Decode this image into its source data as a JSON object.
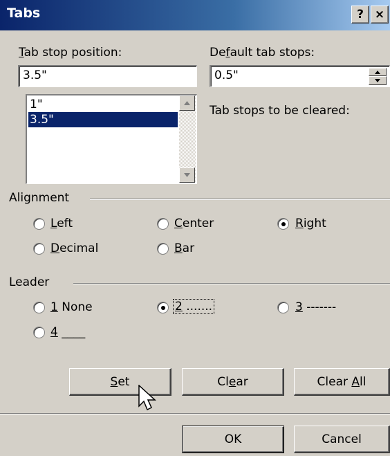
{
  "window": {
    "title": "Tabs",
    "help_label": "?",
    "close_label": "×"
  },
  "tab_stop_position": {
    "label_ul": "T",
    "label_rest": "ab stop position:",
    "value": "3.5\"",
    "list": [
      "1\"",
      "3.5\""
    ],
    "selected_index": 1
  },
  "default_tab_stops": {
    "label_pre": "De",
    "label_ul": "f",
    "label_rest": "ault tab stops:",
    "value": "0.5\""
  },
  "tab_stops_to_be_cleared": {
    "label": "Tab stops to be cleared:"
  },
  "alignment": {
    "label": "Alignment",
    "options": [
      {
        "ul": "L",
        "rest": "eft",
        "checked": false
      },
      {
        "ul": "C",
        "rest": "enter",
        "checked": false
      },
      {
        "ul": "R",
        "rest": "ight",
        "checked": true
      },
      {
        "ul": "D",
        "rest": "ecimal",
        "checked": false
      },
      {
        "ul": "B",
        "rest": "ar",
        "checked": false
      }
    ]
  },
  "leader": {
    "label": "Leader",
    "options": [
      {
        "ul": "1",
        "rest": " None",
        "checked": false
      },
      {
        "ul": "2",
        "rest": " .......",
        "checked": true
      },
      {
        "ul": "3",
        "rest": " -------",
        "checked": false
      },
      {
        "ul": "4",
        "rest": " ____",
        "checked": false
      }
    ]
  },
  "buttons": {
    "set": {
      "ul": "S",
      "rest": "et"
    },
    "clear": {
      "pre": "Cl",
      "ul": "e",
      "rest": "ar"
    },
    "clear_all": {
      "pre": "Clear ",
      "ul": "A",
      "rest": "ll"
    },
    "ok": "OK",
    "cancel": "Cancel"
  },
  "icons": [
    "help-icon",
    "close-icon",
    "spin-up-icon",
    "spin-down-icon",
    "scroll-up-icon",
    "scroll-down-icon",
    "mouse-cursor-icon"
  ]
}
